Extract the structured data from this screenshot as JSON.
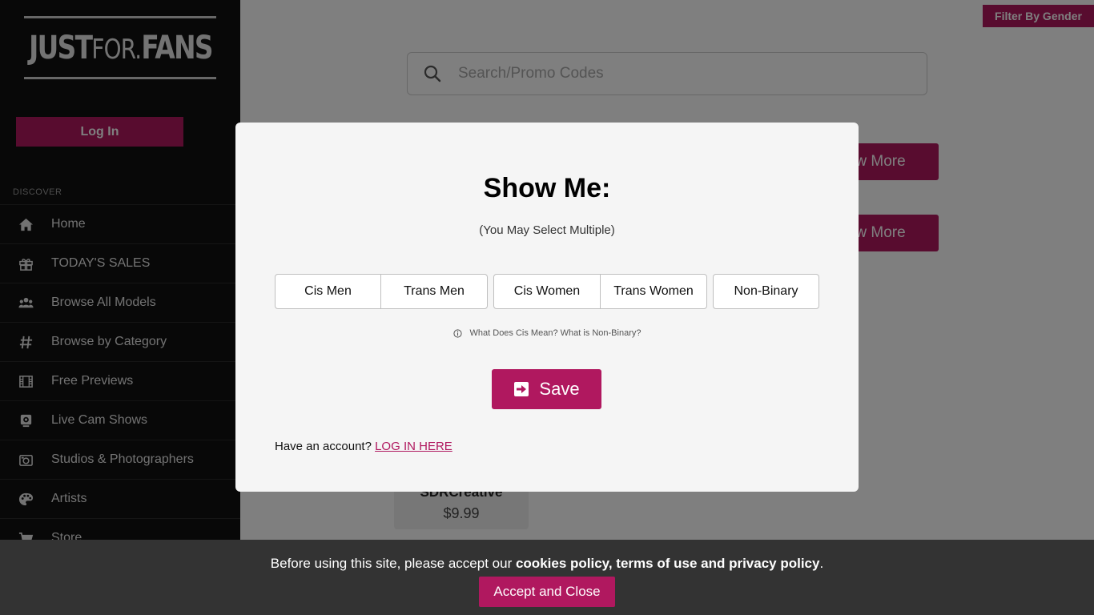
{
  "logo": {
    "part1": "JUST",
    "part2": "FOR.",
    "part3": "FANS"
  },
  "sidebar": {
    "login_label": "Log In",
    "section_title": "DISCOVER",
    "items": [
      {
        "label": "Home",
        "icon": "home-icon"
      },
      {
        "label": "TODAY'S SALES",
        "icon": "gift-icon"
      },
      {
        "label": "Browse All Models",
        "icon": "users-icon"
      },
      {
        "label": "Browse by Category",
        "icon": "hashtag-icon"
      },
      {
        "label": "Free Previews",
        "icon": "film-icon"
      },
      {
        "label": "Live Cam Shows",
        "icon": "webcam-icon"
      },
      {
        "label": "Studios & Photographers",
        "icon": "camera-icon"
      },
      {
        "label": "Artists",
        "icon": "palette-icon"
      },
      {
        "label": "Store",
        "icon": "cart-icon"
      }
    ]
  },
  "header": {
    "filter_label": "Filter By Gender",
    "search_placeholder": "Search/Promo Codes"
  },
  "main": {
    "view_more_label": "View More",
    "card": {
      "name": "SDRCreative",
      "price": "$9.99"
    }
  },
  "modal": {
    "title": "Show Me:",
    "subtitle": "(You May Select Multiple)",
    "options": [
      "Cis Men",
      "Trans Men",
      "Cis Women",
      "Trans Women",
      "Non-Binary"
    ],
    "help_text": "What Does Cis Mean? What is Non-Binary?",
    "save_label": "Save",
    "account_text": "Have an account?",
    "login_link": "LOG IN HERE"
  },
  "cookie": {
    "text_before": "Before using this site, please accept our ",
    "text_bold": "cookies policy, terms of use and privacy policy",
    "text_after": ".",
    "button_label": "Accept and Close"
  },
  "colors": {
    "accent": "#b0185f",
    "sidebar_bg": "#111111",
    "cookie_bg": "#333333",
    "modal_bg": "#f5f5f5"
  }
}
